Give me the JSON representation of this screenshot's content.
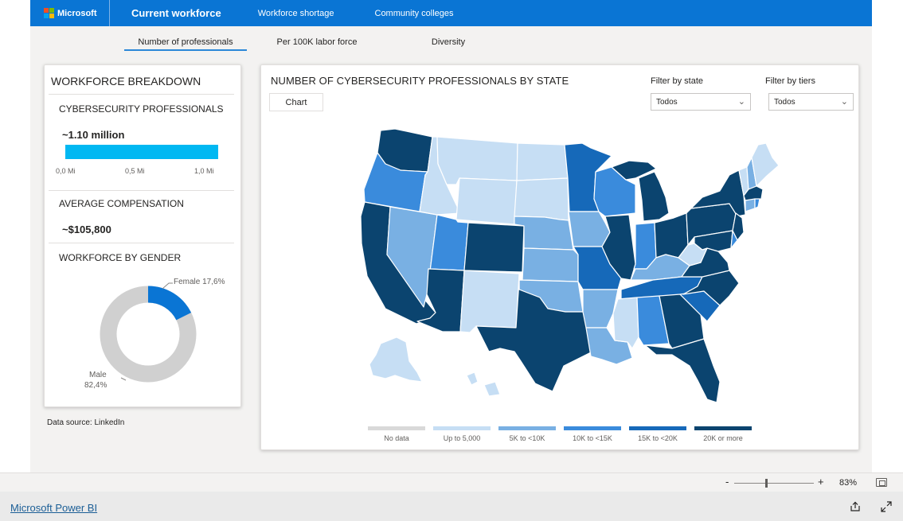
{
  "app": {
    "brand": "Microsoft",
    "nav": [
      "Current workforce",
      "Workforce shortage",
      "Community colleges"
    ]
  },
  "tabs": [
    "Number of professionals",
    "Per 100K labor force",
    "Diversity"
  ],
  "breakdown": {
    "title": "WORKFORCE BREAKDOWN",
    "professionals_label": "CYBERSECURITY PROFESSIONALS",
    "professionals_value": "~1.10 million",
    "professionals_bar_fraction": 1.0,
    "axis_ticks": [
      "0,0 Mi",
      "0,5 Mi",
      "1,0 Mi"
    ],
    "compensation_label": "AVERAGE COMPENSATION",
    "compensation_value": "~$105,800",
    "gender_label": "WORKFORCE BY GENDER",
    "gender": {
      "female_label": "Female 17,6%",
      "male_label": "Male",
      "male_value": "82,4%",
      "female_pct": 17.6,
      "male_pct": 82.4,
      "female_color": "#0a75d4",
      "male_color": "#d0d0d0"
    }
  },
  "source": "Data source: LinkedIn",
  "map": {
    "title": "NUMBER OF CYBERSECURITY PROFESSIONALS BY STATE",
    "chart_button": "Chart",
    "filter_state_label": "Filter by state",
    "filter_state_value": "Todos",
    "filter_tiers_label": "Filter by tiers",
    "filter_tiers_value": "Todos",
    "legend": [
      {
        "label": "No data",
        "color": "#d9d9d9"
      },
      {
        "label": "Up to 5,000",
        "color": "#c6def4"
      },
      {
        "label": "5K to <10K",
        "color": "#79b0e3"
      },
      {
        "label": "10K to <15K",
        "color": "#3a8bdc"
      },
      {
        "label": "15K to <20K",
        "color": "#1669b9"
      },
      {
        "label": "20K or more",
        "color": "#0b446f"
      }
    ]
  },
  "status": {
    "zoom_minus": "-",
    "zoom_plus": "+",
    "zoom_level": "83%",
    "zoom_fraction": 0.4
  },
  "footer": {
    "link": "Microsoft Power BI"
  }
}
